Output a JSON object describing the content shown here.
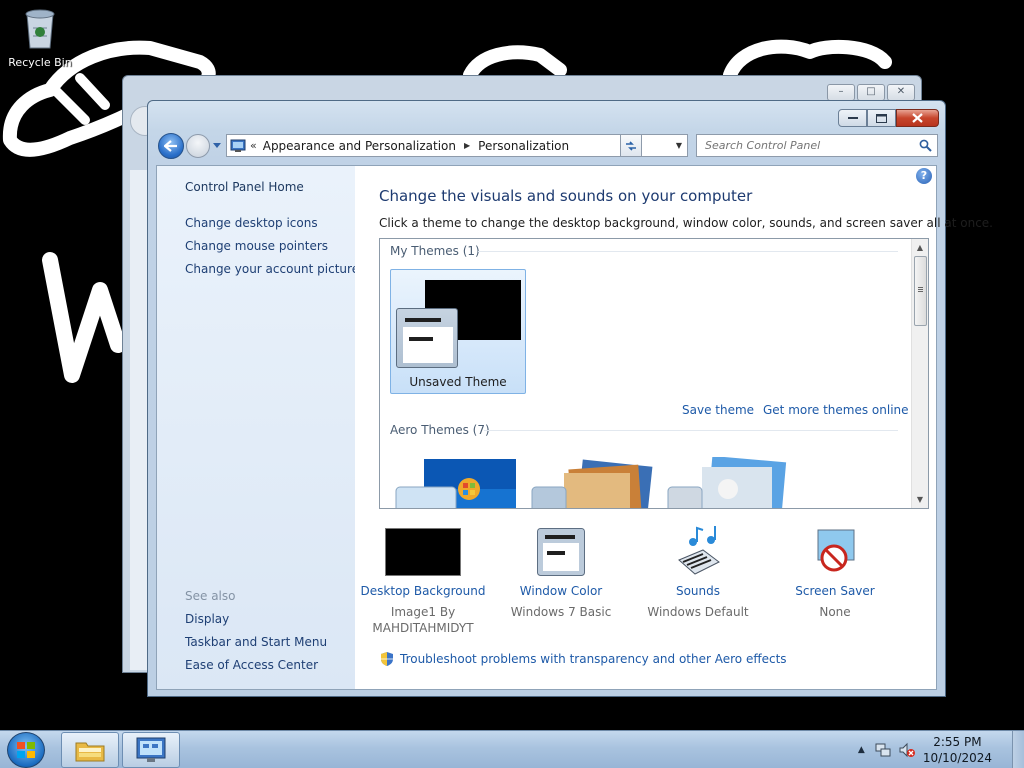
{
  "desktop": {
    "recycle_bin_label": "Recycle Bin"
  },
  "window": {
    "address": {
      "prefix": "«",
      "crumbs": [
        "Appearance and Personalization",
        "Personalization"
      ]
    },
    "search_placeholder": "Search Control Panel"
  },
  "left_pane": {
    "home": "Control Panel Home",
    "links": [
      "Change desktop icons",
      "Change mouse pointers",
      "Change your account picture"
    ],
    "see_also_heading": "See also",
    "see_also": [
      "Display",
      "Taskbar and Start Menu",
      "Ease of Access Center"
    ]
  },
  "main": {
    "title": "Change the visuals and sounds on your computer",
    "subtitle": "Click a theme to change the desktop background, window color, sounds, and screen saver all at once.",
    "my_themes_heading": "My Themes (1)",
    "unsaved_theme": "Unsaved Theme",
    "save_theme": "Save theme",
    "get_more_themes": "Get more themes online",
    "aero_themes_heading": "Aero Themes (7)",
    "bottom": [
      {
        "label": "Desktop Background",
        "value": "Image1 By MAHDITAHMIDYT"
      },
      {
        "label": "Window Color",
        "value": "Windows 7 Basic"
      },
      {
        "label": "Sounds",
        "value": "Windows Default"
      },
      {
        "label": "Screen Saver",
        "value": "None"
      }
    ],
    "troubleshoot": "Troubleshoot problems with transparency and other Aero effects"
  },
  "taskbar": {
    "time": "2:55 PM",
    "date": "10/10/2024"
  },
  "colors": {
    "link": "#1e5aa8",
    "title": "#1d3a70",
    "taskbar": "#a9c3df"
  },
  "icons": [
    "recycle-bin-icon",
    "control-panel-icon",
    "search-icon",
    "help-icon",
    "refresh-icon",
    "shield-icon",
    "start-orb-icon",
    "explorer-icon",
    "volume-muted-icon",
    "network-icon"
  ]
}
